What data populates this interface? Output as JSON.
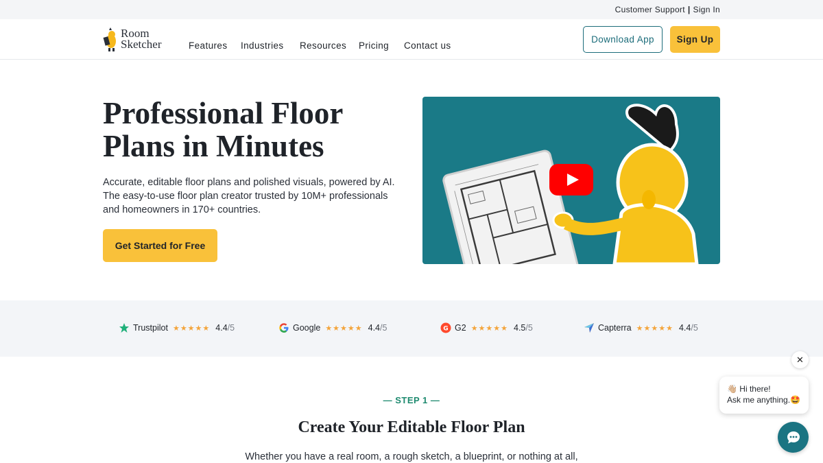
{
  "topbar": {
    "support": "Customer Support",
    "separator": "|",
    "signin": "Sign In"
  },
  "logo": {
    "line1": "Room",
    "line2": "Sketcher"
  },
  "nav": [
    "Features",
    "Industries",
    "Resources",
    "Pricing",
    "Contact us"
  ],
  "header": {
    "download": "Download App",
    "signup": "Sign Up"
  },
  "hero": {
    "title_line1": "Professional Floor",
    "title_line2": "Plans in Minutes",
    "desc": "Accurate, editable floor plans and polished visuals, powered by AI. The easy-to-use floor plan creator trusted by 10M+ professionals and homeowners in 170+ countries.",
    "cta": "Get Started for Free"
  },
  "ratings": [
    {
      "name": "Trustpilot",
      "score": "4.4",
      "max": "/5",
      "stars": 4.4,
      "icon": "trustpilot-star-icon",
      "color": "#20b07a"
    },
    {
      "name": "Google",
      "score": "4.4",
      "max": "/5",
      "stars": 4.4,
      "icon": "google-g-icon",
      "color": "#4285f4"
    },
    {
      "name": "G2",
      "score": "4.5",
      "max": "/5",
      "stars": 4.5,
      "icon": "g2-icon",
      "color": "#ff492c"
    },
    {
      "name": "Capterra",
      "score": "4.4",
      "max": "/5",
      "stars": 4.4,
      "icon": "capterra-arrow-icon",
      "color": "#ff9d28"
    }
  ],
  "step": {
    "label": "— STEP 1 —",
    "title": "Create Your Editable Floor Plan",
    "desc": "Whether you have a real room, a rough sketch, a blueprint, or nothing at all,"
  },
  "chat": {
    "line1": "👋🏼 Hi there!",
    "line2": "Ask me anything.🤩",
    "close": "✕"
  },
  "colors": {
    "accent": "#f9c13a",
    "teal": "#1b6c7a",
    "step_green": "#1e8a6f"
  }
}
